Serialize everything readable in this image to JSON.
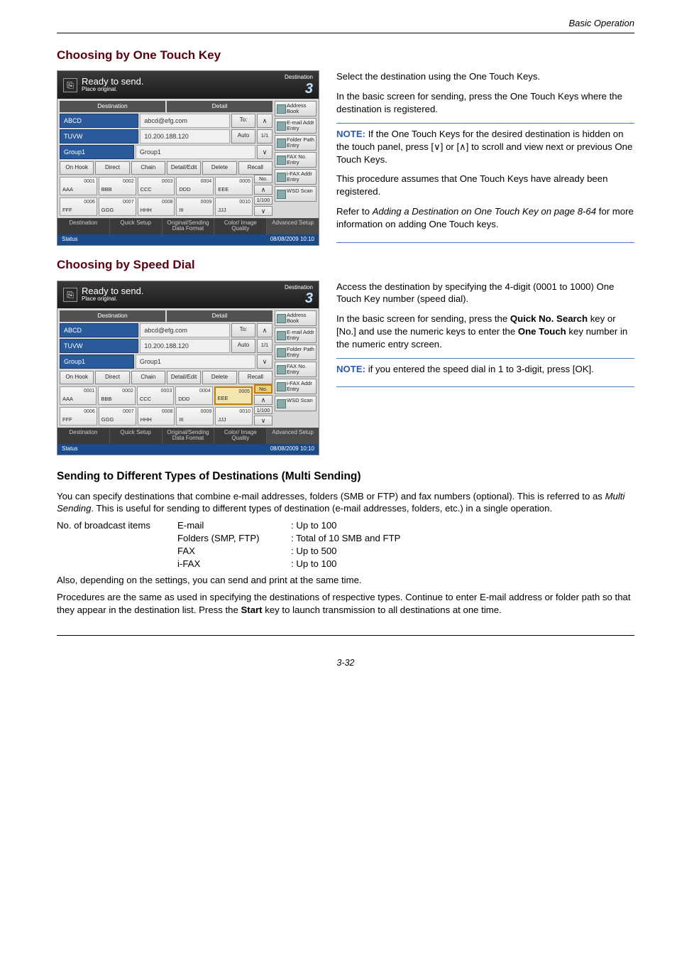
{
  "doc": {
    "header_meta": "Basic Operation",
    "page_num": "3-32"
  },
  "s1": {
    "title": "Choosing by One Touch Key",
    "p1": "Select the destination using the One Touch Keys.",
    "p2": "In the basic screen for sending, press the One Touch Keys where the destination is registered.",
    "note_label": "NOTE:",
    "note1a": " If the One Touch Keys for the desired destination is hidden on the touch panel, press [",
    "note1b": "] or [",
    "note1c": "] to scroll and view next or previous One Touch Keys.",
    "note2": "This procedure assumes that One Touch Keys have already been registered.",
    "note3a": "Refer to ",
    "note3i": "Adding a Destination on One Touch Key on page 8-64",
    "note3b": " for more information on adding One Touch keys."
  },
  "s2": {
    "title": "Choosing by Speed Dial",
    "p1": "Access the destination by specifying the 4-digit (0001 to 1000) One Touch Key number (speed dial).",
    "p2a": "In the basic screen for sending, press the ",
    "p2b": "Quick No. Search",
    "p2c": " key or [No.] and use the numeric keys to enter the ",
    "p2d": "One Touch",
    "p2e": " key number in the numeric entry screen.",
    "note_label": "NOTE:",
    "note": " if you entered the speed dial in 1 to 3-digit, press [OK]."
  },
  "s3": {
    "title": "Sending to Different Types of Destinations (Multi Sending)",
    "p1a": "You can specify destinations that combine e-mail addresses, folders (SMB or FTP) and fax numbers (optional). This is referred to as ",
    "p1i": "Multi Sending",
    "p1b": ". This is useful for sending to different types of destination (e-mail addresses, folders, etc.) in a single operation.",
    "spec_label": "No. of broadcast items",
    "rows": [
      {
        "m": "E-mail",
        "r": ": Up to 100"
      },
      {
        "m": "Folders (SMP, FTP)",
        "r": ": Total of 10 SMB and FTP"
      },
      {
        "m": "FAX",
        "r": ": Up to 500"
      },
      {
        "m": "i-FAX",
        "r": ": Up to 100"
      }
    ],
    "p2": "Also, depending on the settings, you can send and print at the same time.",
    "p3a": "Procedures are the same as used in specifying the destinations of respective types. Continue to enter E-mail address or folder path so that they appear in the destination list. Press the ",
    "p3b": "Start",
    "p3c": " key to launch transmission to all destinations at one time."
  },
  "panel": {
    "ready": "Ready to send.",
    "place": "Place original.",
    "dest_word": "Destination",
    "big3": "3",
    "tab_dest": "Destination",
    "tab_detail": "Detail",
    "rows": [
      {
        "name": "ABCD",
        "detail": "abcd@efg.com",
        "btn": "To:"
      },
      {
        "name": "TUVW",
        "detail": "10.200.188.120",
        "btn": "Auto",
        "count": "1/1"
      },
      {
        "name": "Group1",
        "detail": "Group1"
      }
    ],
    "toolbar": [
      "On Hook",
      "Direct",
      "Chain",
      "Detail/Edit",
      "Delete",
      "Recall"
    ],
    "onetouch_r1": [
      {
        "n": "0001",
        "l": "AAA"
      },
      {
        "n": "0002",
        "l": "BBB"
      },
      {
        "n": "0003",
        "l": "CCC"
      },
      {
        "n": "0004",
        "l": "DDD"
      },
      {
        "n": "0005",
        "l": "EEE"
      }
    ],
    "onetouch_r2": [
      {
        "n": "0006",
        "l": "FFF"
      },
      {
        "n": "0007",
        "l": "GGG"
      },
      {
        "n": "0008",
        "l": "HHH"
      },
      {
        "n": "0009",
        "l": "III"
      },
      {
        "n": "0010",
        "l": "JJJ"
      }
    ],
    "no_label": "No.",
    "page_ind": "1/100",
    "side": [
      "Address Book",
      "E-mail Addr Entry",
      "Folder Path Entry",
      "FAX No. Entry",
      "i-FAX Addr Entry",
      "WSD Scan"
    ],
    "foot": [
      "Destination",
      "Quick Setup",
      "Original/Sending Data Format",
      "Color/ Image Quality",
      "Advanced Setup"
    ],
    "status": "Status",
    "datetime": "08/08/2009   10:10"
  }
}
